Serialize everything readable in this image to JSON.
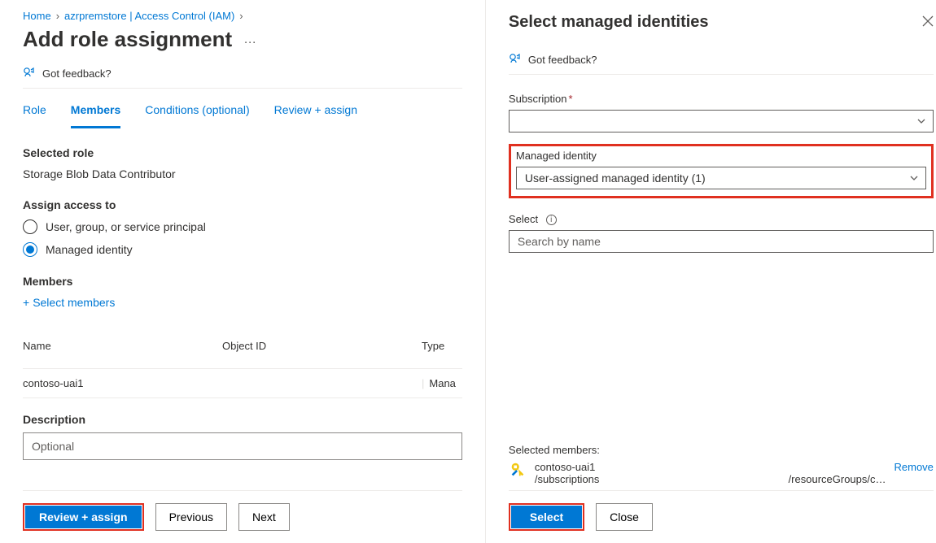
{
  "breadcrumb": {
    "home": "Home",
    "parent": "azrpremstore | Access Control (IAM)"
  },
  "page": {
    "title": "Add role assignment",
    "more_menu": "…"
  },
  "feedback": "Got feedback?",
  "tabs": {
    "role": "Role",
    "members": "Members",
    "conditions": "Conditions (optional)",
    "review": "Review + assign"
  },
  "selected_role": {
    "label": "Selected role",
    "value": "Storage Blob Data Contributor"
  },
  "assign_access": {
    "label": "Assign access to",
    "option1": "User, group, or service principal",
    "option2": "Managed identity",
    "selected": "option2"
  },
  "members": {
    "label": "Members",
    "select_link": "Select members"
  },
  "table": {
    "headers": {
      "name": "Name",
      "oid": "Object ID",
      "type": "Type"
    },
    "rows": [
      {
        "name": "contoso-uai1",
        "oid": "",
        "type": "Mana"
      }
    ]
  },
  "description": {
    "label": "Description",
    "placeholder": "Optional"
  },
  "main_buttons": {
    "review": "Review + assign",
    "previous": "Previous",
    "next": "Next"
  },
  "panel": {
    "title": "Select managed identities",
    "feedback": "Got feedback?",
    "subscription_label": "Subscription",
    "subscription_value": "",
    "managed_identity_label": "Managed identity",
    "managed_identity_value": "User-assigned managed identity (1)",
    "select_label": "Select",
    "search_placeholder": "Search by name",
    "selected_members_label": "Selected members:",
    "member": {
      "name": "contoso-uai1",
      "sub": "/subscriptions",
      "path_tail": "/resourceGroups/c…",
      "remove": "Remove"
    },
    "buttons": {
      "select": "Select",
      "close": "Close"
    }
  }
}
